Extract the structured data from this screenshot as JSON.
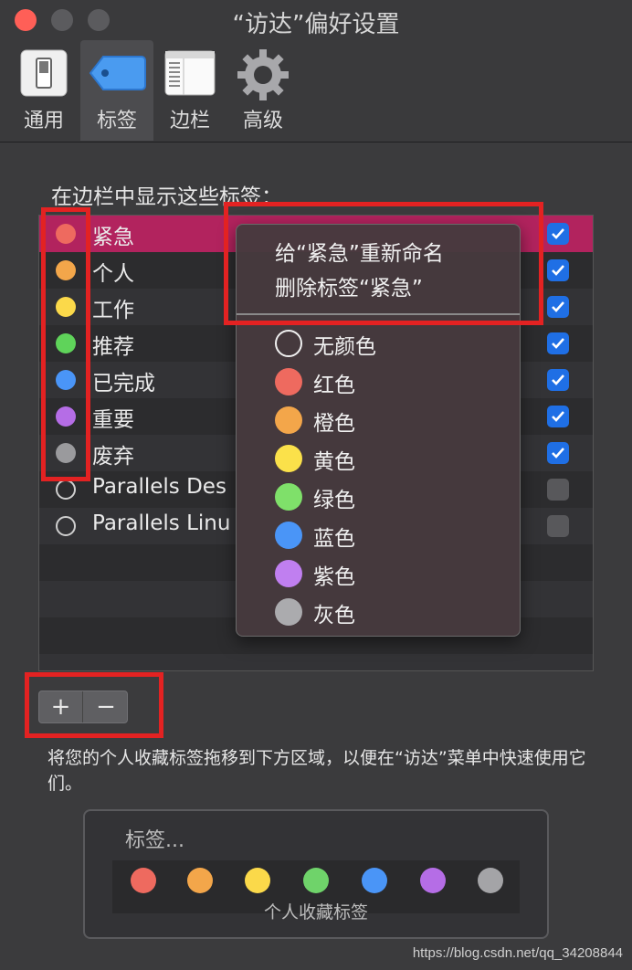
{
  "window": {
    "title": "“访达”偏好设置"
  },
  "toolbar": {
    "tabs": [
      {
        "label": "通用",
        "icon": "switch-icon"
      },
      {
        "label": "标签",
        "icon": "tag-icon",
        "active": true
      },
      {
        "label": "边栏",
        "icon": "sidebar-icon"
      },
      {
        "label": "高级",
        "icon": "gear-icon"
      }
    ]
  },
  "tags_section": {
    "title": "在边栏中显示这些标签：",
    "items": [
      {
        "name": "紧急",
        "color": "#ee6a5f",
        "checked": true,
        "selected": true
      },
      {
        "name": "个人",
        "color": "#f3a64a",
        "checked": true
      },
      {
        "name": "工作",
        "color": "#fbd94a",
        "checked": true
      },
      {
        "name": "推荐",
        "color": "#5fd35a",
        "checked": true
      },
      {
        "name": "已完成",
        "color": "#4a95f7",
        "checked": true
      },
      {
        "name": "重要",
        "color": "#b56de6",
        "checked": true
      },
      {
        "name": "废弃",
        "color": "#9a9a9d",
        "checked": true
      },
      {
        "name": "Parallels Des",
        "color": null,
        "checked": false
      },
      {
        "name": "Parallels Linu",
        "color": null,
        "checked": false
      }
    ]
  },
  "context_menu": {
    "rename": "给“紧急”重新命名",
    "delete": "删除标签“紧急”",
    "colors": [
      {
        "label": "无颜色",
        "color": null
      },
      {
        "label": "红色",
        "color": "#ee6a5f"
      },
      {
        "label": "橙色",
        "color": "#f3a64a"
      },
      {
        "label": "黄色",
        "color": "#fbe14a"
      },
      {
        "label": "绿色",
        "color": "#7fe06a"
      },
      {
        "label": "蓝色",
        "color": "#4a95f7"
      },
      {
        "label": "紫色",
        "color": "#c07ff0"
      },
      {
        "label": "灰色",
        "color": "#ababae"
      }
    ]
  },
  "buttons": {
    "add": "+",
    "remove": "−"
  },
  "help_text": "将您的个人收藏标签拖移到下方区域，以便在“访达”菜单中快速使用它们。",
  "favorites": {
    "title": "标签...",
    "caption": "个人收藏标签",
    "colors": [
      "#ee6a5f",
      "#f3a64a",
      "#fbd94a",
      "#6fd36a",
      "#4a95f7",
      "#b56de6",
      "#a4a4a7"
    ]
  },
  "watermark": "https://blog.csdn.net/qq_34208844"
}
